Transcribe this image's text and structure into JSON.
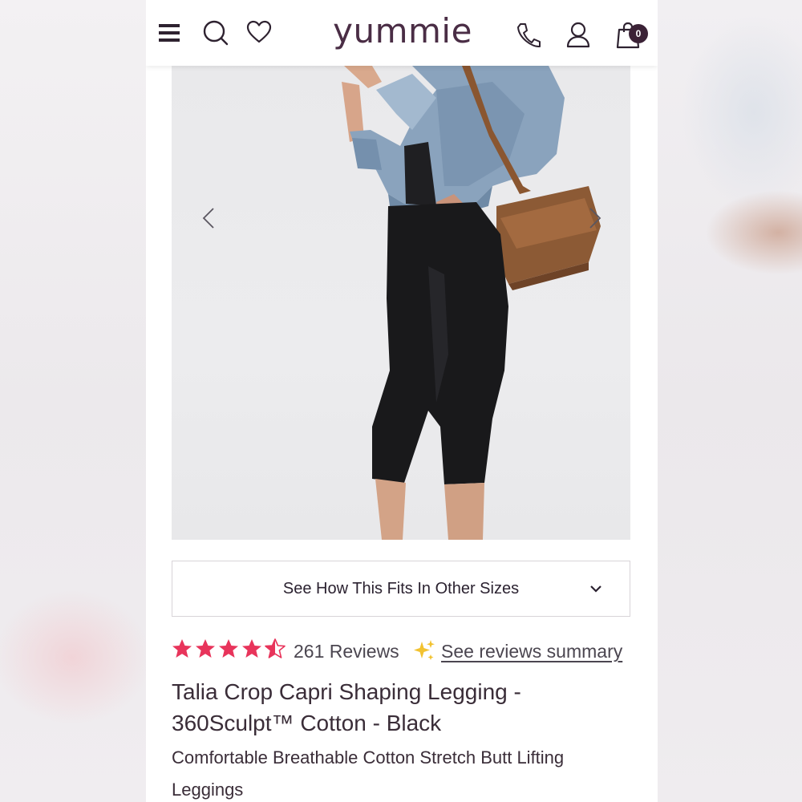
{
  "header": {
    "logo_text": "yummie",
    "icons": [
      "menu-icon",
      "search-icon",
      "heart-icon",
      "phone-icon",
      "user-icon",
      "bag-icon"
    ],
    "cart_count": "0",
    "brand_color": "#4a2d45"
  },
  "gallery": {
    "image_alt": "Model wearing black capri leggings with denim jacket and brown shoulder bag",
    "prev_icon": "chevron-left-icon",
    "next_icon": "chevron-right-icon"
  },
  "fit": {
    "label": "See How This Fits In Other Sizes",
    "icon": "chevron-down-icon"
  },
  "rating": {
    "stars": 4.5,
    "star_color": "#e8345b",
    "reviews_label": "261 Reviews",
    "summary_link": "See reviews summary",
    "sparkle_color": "#f2c230"
  },
  "product": {
    "title_line1": "Talia Crop Capri Shaping Legging -",
    "title_line2": "360Sculpt™ Cotton - Black",
    "subtitle_line1": "Comfortable Breathable Cotton Stretch Butt Lifting",
    "subtitle_line2": "Leggings"
  }
}
